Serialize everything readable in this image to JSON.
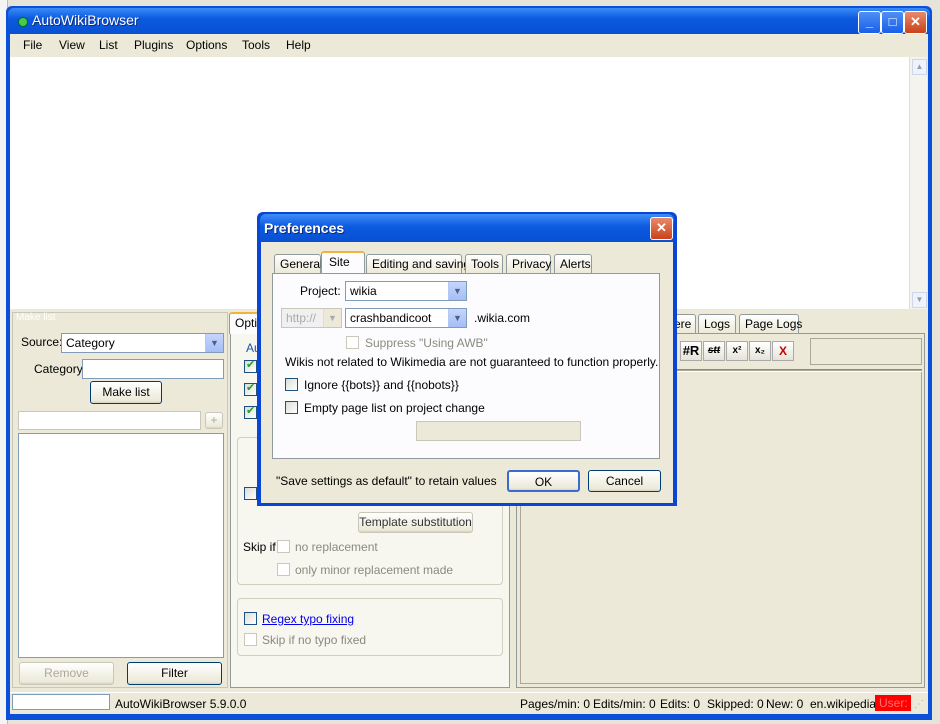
{
  "window": {
    "title": "AutoWikiBrowser"
  },
  "menu": [
    "File",
    "View",
    "List",
    "Plugins",
    "Options",
    "Tools",
    "Help"
  ],
  "make_list": {
    "header": "Make list",
    "source_label": "Source:",
    "source_value": "Category",
    "category_label": "Category:",
    "category_value": "",
    "make_list_button": "Make list",
    "add_button": "+",
    "remove_button": "Remove",
    "filter_button": "Filter"
  },
  "options_panel": {
    "tab_label": "Optio",
    "group_label": "Au",
    "template_substitution_button": "Template substitution",
    "skip_if_label": "Skip if",
    "no_replacement": "no replacement",
    "only_minor": "only minor replacement made",
    "regex_typo": "Regex typo fixing",
    "skip_no_typo": "Skip if no typo fixed"
  },
  "right_panel": {
    "tabs": [
      "ere",
      "Logs",
      "Page Logs"
    ],
    "toolbar": [
      "#R",
      "stt",
      "x²",
      "x₂",
      "X"
    ]
  },
  "status": {
    "version": "AutoWikiBrowser 5.9.0.0",
    "pages_min": "Pages/min: 0",
    "edits_min": "Edits/min: 0",
    "edits": "Edits: 0",
    "skipped": "Skipped: 0",
    "new": "New: 0",
    "wiki": "en.wikipedia",
    "user": "User:",
    "user_color": "#ff0000"
  },
  "preferences": {
    "title": "Preferences",
    "tabs": [
      "General",
      "Site",
      "Editing and saving",
      "Tools",
      "Privacy",
      "Alerts"
    ],
    "project_label": "Project:",
    "project_value": "wikia",
    "protocol_value": "http://",
    "subdomain_value": "crashbandicoot",
    "domain_suffix": ".wikia.com",
    "suppress_label": "Suppress \"Using AWB\"",
    "warning": "Wikis not related to Wikimedia are not guaranteed to function properly.",
    "ignore_bots": "Ignore {{bots}} and {{nobots}}",
    "empty_page_list": "Empty page list on project change",
    "footer_note": "\"Save settings as default\" to retain values",
    "ok": "OK",
    "cancel": "Cancel"
  }
}
